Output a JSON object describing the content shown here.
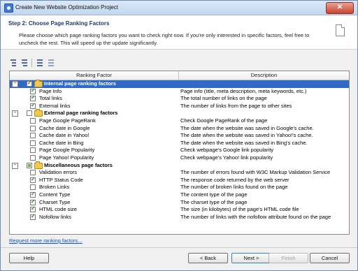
{
  "window": {
    "title": "Create New Website Optimization Project",
    "close_glyph": "✕"
  },
  "header": {
    "step_title": "Step 2: Choose Page Ranking Factors",
    "description": "Please choose which page ranking factors you want to check right now. If you're only interested in specific factors, feel free to uncheck the rest. This will speed up the update significantly."
  },
  "grid": {
    "columns": [
      "Ranking Factor",
      "Description"
    ],
    "rows": [
      {
        "type": "group",
        "expander": "−",
        "check": "checked",
        "label": "Internal page ranking factors",
        "description": "",
        "selected": true
      },
      {
        "type": "item",
        "check": "checked",
        "label": "Page Info",
        "description": "Page info (title, meta description, meta keywords, etc.)"
      },
      {
        "type": "item",
        "check": "checked",
        "label": "Total links",
        "description": "The total number of links on the page"
      },
      {
        "type": "item",
        "check": "checked",
        "label": "External links",
        "description": "The number of links from the page to other sites"
      },
      {
        "type": "group",
        "expander": "−",
        "check": "unchecked",
        "label": "External page ranking factors",
        "description": ""
      },
      {
        "type": "item",
        "check": "unchecked",
        "label": "Page Google PageRank",
        "description": "Check Google PageRank of the page"
      },
      {
        "type": "item",
        "check": "unchecked",
        "label": "Cache date in Google",
        "description": "The date when the website was saved in Google's cache."
      },
      {
        "type": "item",
        "check": "unchecked",
        "label": "Cache date in Yahoo!",
        "description": "The date when the website was saved in Yahoo!'s cache."
      },
      {
        "type": "item",
        "check": "unchecked",
        "label": "Cache date in Bing",
        "description": "The date when the website was saved in Bing's cache."
      },
      {
        "type": "item",
        "check": "unchecked",
        "label": "Page Google Popularity",
        "description": "Check webpage's Google link popularity"
      },
      {
        "type": "item",
        "check": "unchecked",
        "label": "Page Yahoo! Popularity",
        "description": "Check webpage's Yahoo! link popularity"
      },
      {
        "type": "group",
        "expander": "−",
        "check": "partial",
        "label": "Miscellaneous page factors",
        "description": ""
      },
      {
        "type": "item",
        "check": "unchecked",
        "label": "Validation  errors",
        "description": "The number of errors found with W3C Markup Validation Service"
      },
      {
        "type": "item",
        "check": "checked",
        "label": "HTTP Status Code",
        "description": "The response code returned by the web server"
      },
      {
        "type": "item",
        "check": "unchecked",
        "label": "Broken Links",
        "description": "The number of broken links found on the page"
      },
      {
        "type": "item",
        "check": "checked",
        "label": "Content Type",
        "description": "The content type of the page"
      },
      {
        "type": "item",
        "check": "checked",
        "label": "Charset Type",
        "description": "The charset type of the page"
      },
      {
        "type": "item",
        "check": "checked",
        "label": "HTML code size",
        "description": "The size (in kilobytes) of the page's HTML code file"
      },
      {
        "type": "item",
        "check": "checked",
        "label": "Nofollow links",
        "description": "The number of links with the nofollow attribute found on the page"
      }
    ]
  },
  "link": {
    "more_factors": "Request more ranking factors..."
  },
  "buttons": {
    "help": "Help",
    "back": "< Back",
    "next": "Next >",
    "finish": "Finish",
    "cancel": "Cancel"
  }
}
